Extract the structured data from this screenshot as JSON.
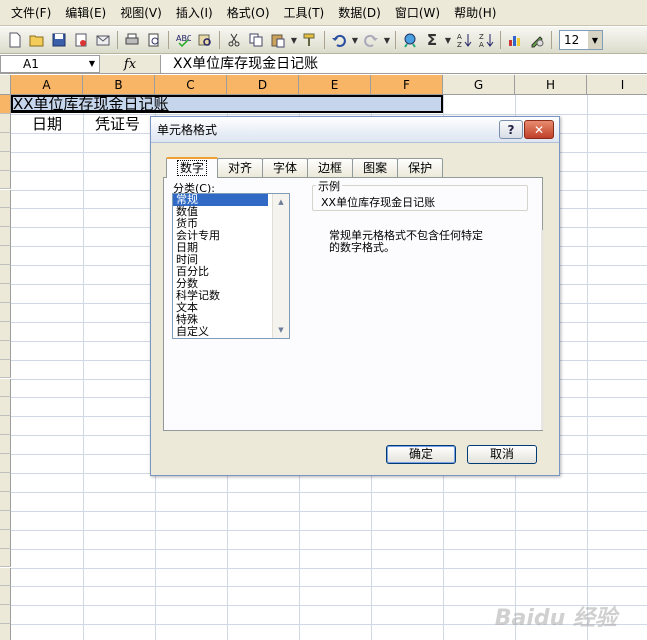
{
  "menubar": {
    "items": [
      "文件(F)",
      "编辑(E)",
      "视图(V)",
      "插入(I)",
      "格式(O)",
      "工具(T)",
      "数据(D)",
      "窗口(W)",
      "帮助(H)"
    ]
  },
  "toolbar": {
    "icons": [
      "new-icon",
      "open-icon",
      "save-icon",
      "permission-icon",
      "email-icon",
      "print-icon",
      "print-preview-icon",
      "spelling-icon",
      "research-icon",
      "cut-icon",
      "copy-icon",
      "paste-icon",
      "format-painter-icon",
      "undo-icon",
      "redo-icon",
      "hyperlink-icon",
      "autosum-icon",
      "sort-ascending-icon",
      "sort-descending-icon",
      "chart-wizard-icon",
      "drawing-icon"
    ],
    "sigma": "Σ",
    "font_size": "12"
  },
  "formula_bar": {
    "name_box": "A1",
    "fx_label": "fx",
    "content": "XX单位库存现金日记账"
  },
  "sheet": {
    "columns": [
      "A",
      "B",
      "C",
      "D",
      "E",
      "F",
      "G",
      "H",
      "I"
    ],
    "a1_text": "XX单位库存现金日记账",
    "a2_text": "日期",
    "b2_text": "凭证号"
  },
  "dialog": {
    "title": "单元格格式",
    "help_symbol": "?",
    "close_symbol": "✕",
    "tabs": [
      "数字",
      "对齐",
      "字体",
      "边框",
      "图案",
      "保护"
    ],
    "active_tab": "数字",
    "category_label": "分类(C):",
    "categories": [
      "常规",
      "数值",
      "货币",
      "会计专用",
      "日期",
      "时间",
      "百分比",
      "分数",
      "科学记数",
      "文本",
      "特殊",
      "自定义"
    ],
    "selected_category": "常规",
    "sample_label": "示例",
    "sample_value": "XX单位库存现金日记账",
    "description_line1": "常规单元格格式不包含任何特定",
    "description_line2": "的数字格式。",
    "ok_label": "确定",
    "cancel_label": "取消"
  },
  "watermark": "Baidu 经验",
  "colors": {
    "selected_header": "#f7b565",
    "selected_cell": "#c5d5ec",
    "selected_list_item": "#316ac5",
    "tab_highlight": "#f0a030",
    "close_button": "#c0402a"
  }
}
